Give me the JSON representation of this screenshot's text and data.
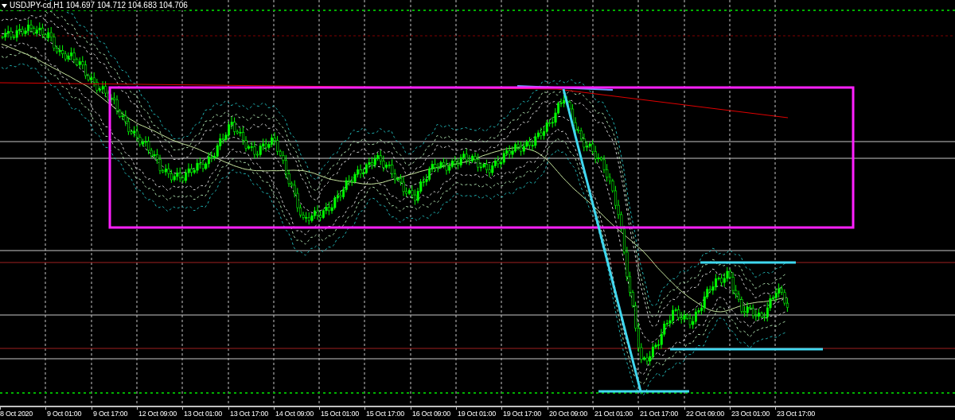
{
  "chart": {
    "symbol": "USDJPY-cd,H1",
    "quote": [
      "104.697",
      "104.712",
      "104.683",
      "104.706"
    ]
  },
  "time_axis": [
    "8 Oct 2020",
    "9 Oct 01:00",
    "9 Oct 17:00",
    "12 Oct 09:00",
    "13 Oct 01:00",
    "13 Oct 17:00",
    "14 Oct 09:00",
    "15 Oct 01:00",
    "15 Oct 17:00",
    "16 Oct 09:00",
    "19 Oct 01:00",
    "19 Oct 17:00",
    "20 Oct 09:00",
    "21 Oct 01:00",
    "21 Oct 17:00",
    "22 Oct 09:00",
    "23 Oct 01:00",
    "23 Oct 17:00"
  ]
}
